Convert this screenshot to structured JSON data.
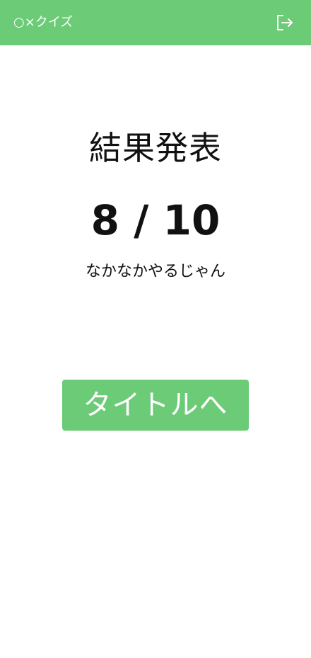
{
  "header": {
    "title": "○×クイズ",
    "exit_icon": "logout-icon"
  },
  "result": {
    "heading": "結果発表",
    "score": "8 / 10",
    "score_correct": 8,
    "score_total": 10,
    "comment": "なかなかやるじゃん"
  },
  "actions": {
    "back_to_title_label": "タイトルへ"
  },
  "colors": {
    "accent": "#6CCB77",
    "text": "#111111",
    "background": "#FFFFFF"
  }
}
